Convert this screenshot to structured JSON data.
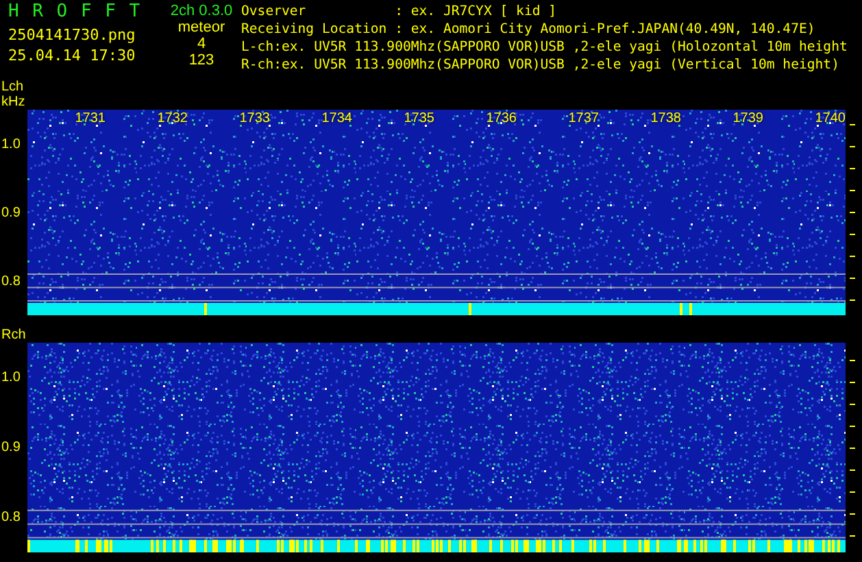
{
  "header": {
    "title": "H R O F F T",
    "version": "2ch 0.3.0",
    "filename": "2504141730.png",
    "datetime": "25.04.14 17:30",
    "mode": "meteor",
    "counts": [
      "4",
      "123"
    ],
    "info": [
      {
        "label": "Ovserver",
        "separator": ":",
        "value": "ex. JR7CYX [ kid ]"
      },
      {
        "label": "Receiving Location",
        "separator": ":",
        "value": "ex. Aomori City Aomori-Pref.JAPAN(40.49N, 140.47E)"
      },
      {
        "label": "L-ch",
        "separator": ":",
        "value": "ex. UV5R 113.900Mhz(SAPPORO VOR)USB ,2-ele yagi (Holozontal 10m height"
      },
      {
        "label": "R-ch",
        "separator": ":",
        "value": "ex. UV5R 113.900Mhz(SAPPORO VOR)USB ,2-ele yagi (Vertical 10m height)"
      }
    ]
  },
  "channels": [
    {
      "label": "Lch",
      "unit": "kHz",
      "time_labels": [
        "1731",
        "1732",
        "1733",
        "1734",
        "1735",
        "1736",
        "1737",
        "1738",
        "1739",
        "1740"
      ],
      "yticks": [
        "1.0",
        "0.9",
        "0.8"
      ]
    },
    {
      "label": "Rch",
      "yticks": [
        "1.0",
        "0.9",
        "0.8"
      ]
    }
  ]
}
